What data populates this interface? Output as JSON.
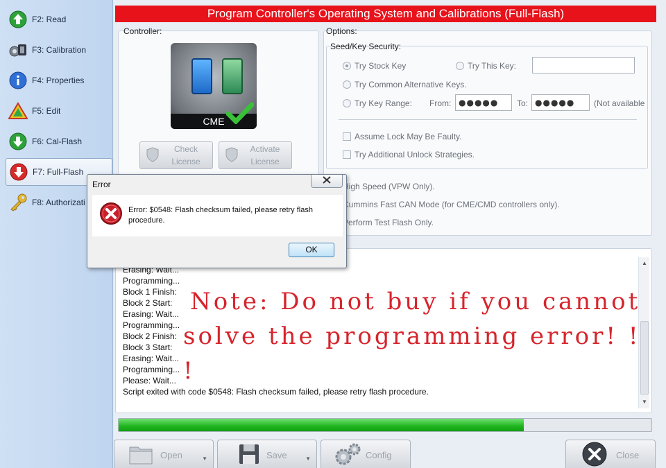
{
  "sidebar": {
    "items": [
      {
        "label": "F2: Read",
        "icon": "green-up-arrow-icon"
      },
      {
        "label": "F3: Calibration",
        "icon": "wrench-gear-icon"
      },
      {
        "label": "F4: Properties",
        "icon": "info-icon"
      },
      {
        "label": "F5: Edit",
        "icon": "warning-triangle-icon"
      },
      {
        "label": "F6: Cal-Flash",
        "icon": "green-down-arrow-icon"
      },
      {
        "label": "F7: Full-Flash",
        "icon": "red-down-arrow-icon",
        "active": true
      },
      {
        "label": "F8: Authorizati",
        "icon": "key-icon"
      }
    ]
  },
  "header": {
    "title": "Program Controller's Operating System and Calibrations (Full-Flash)",
    "color": "#e8121b"
  },
  "controller": {
    "label": "Controller:",
    "image_text": "CME",
    "check_license": [
      "Check",
      "License"
    ],
    "activate_license": [
      "Activate",
      "License"
    ]
  },
  "options": {
    "label": "Options:",
    "seed_key": {
      "label": "Seed/Key Security:",
      "try_stock_key": "Try Stock Key",
      "try_this_key": "Try This Key:",
      "try_this_key_value": "",
      "try_common": "Try Common Alternative Keys.",
      "try_range": "Try Key Range:",
      "from_label": "From:",
      "from_value": "●●●●●",
      "to_label": "To:",
      "to_value": "●●●●●",
      "not_available": "(Not available",
      "assume_lock": "Assume Lock May Be Faulty.",
      "try_additional": "Try Additional Unlock Strategies."
    },
    "high_speed": "High Speed (VPW Only).",
    "cummins_can": "Cummins Fast CAN Mode (for CME/CMD controllers only).",
    "test_flash": "Perform Test Flash Only."
  },
  "log": {
    "lines": [
      "Erasing: Wait...",
      "Programming...",
      "Block 1 Finish:",
      "Block 2 Start:",
      "Erasing: Wait...",
      "Programming...",
      "Block 2 Finish:",
      "Block 3 Start:",
      "Erasing: Wait...",
      "Programming...",
      "Please: Wait...",
      "Script exited with code $0548: Flash checksum failed, please retry flash procedure."
    ]
  },
  "note": {
    "line1": "Note: Do not buy if you cannot",
    "line2": "solve the programming error! ! !",
    "color": "#d6242c"
  },
  "progress": {
    "fraction": 0.76
  },
  "toolbar": {
    "open": "Open",
    "save": "Save",
    "config": "Config",
    "close": "Close"
  },
  "dialog": {
    "title": "Error",
    "message": "Error: $0548: Flash checksum failed, please retry flash procedure.",
    "ok": "OK",
    "icon": "error-x-icon"
  }
}
